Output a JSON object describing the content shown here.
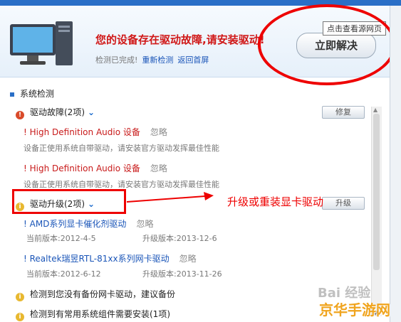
{
  "header": {
    "warning": "您的设备存在驱动故障,请安装驱动!",
    "status": "检测已完成!",
    "recheck": "重新检测",
    "back": "返回首屏",
    "fix_button": "立即解决",
    "tooltip": "点击查看源网页"
  },
  "section": {
    "title": "系统检测"
  },
  "fault_group": {
    "label": "驱动故障(2项)",
    "button": "修复"
  },
  "fault_items": [
    {
      "name": "! High Definition Audio 设备",
      "ignore": "忽略",
      "desc": "设备正使用系统自带驱动，请安装官方驱动发挥最佳性能"
    },
    {
      "name": "! High Definition Audio 设备",
      "ignore": "忽略",
      "desc": "设备正使用系统自带驱动，请安装官方驱动发挥最佳性能"
    }
  ],
  "upgrade_group": {
    "label": "驱动升级(2项)",
    "button": "升级"
  },
  "upgrade_items": [
    {
      "name": "! AMD系列显卡催化剂驱动",
      "ignore": "忽略",
      "current": "当前版本:2012-4-5",
      "upgrade": "升级版本:2013-12-6"
    },
    {
      "name": "! Realtek瑞昱RTL-81xx系列网卡驱动",
      "ignore": "忽略",
      "current": "当前版本:2012-6-12",
      "upgrade": "升级版本:2013-11-26"
    }
  ],
  "notices": [
    {
      "text": "检测到您没有备份网卡驱动，建议备份"
    },
    {
      "text": "检测到有常用系统组件需要安装(1项)"
    }
  ],
  "annotation": "升级或重装显卡驱动",
  "watermark": {
    "text1": "Bai  经验",
    "text2": "京华手游网"
  },
  "colors": {
    "accent": "#2a6fc7",
    "danger": "#d01818",
    "link": "#1a55b8"
  }
}
